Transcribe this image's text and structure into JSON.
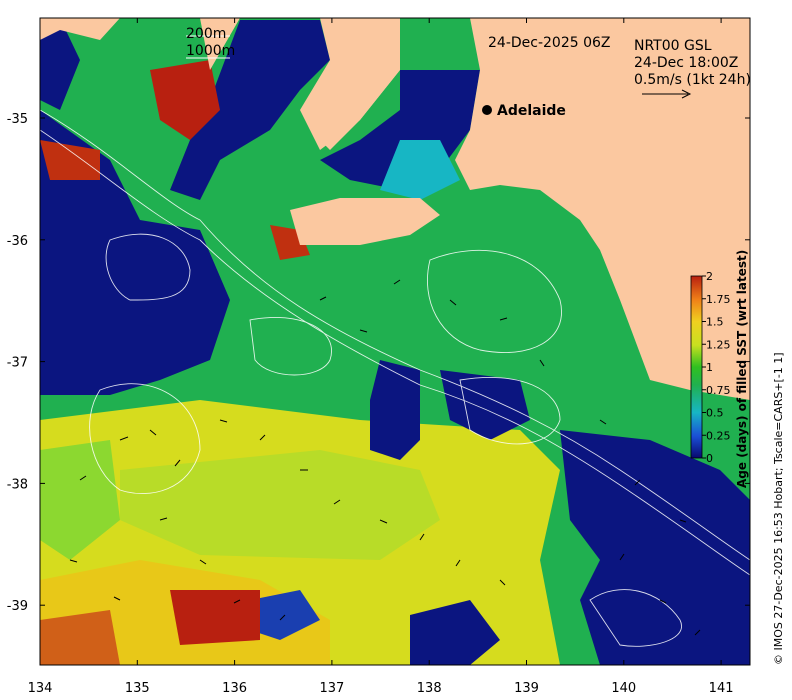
{
  "map": {
    "timestamp": "24-Dec-2025 06Z",
    "product": "NRT00 GSL",
    "current_time": "24-Dec 18:00Z",
    "current_scale": "0.5m/s (1kt 24h)",
    "depth_legend": [
      "200m",
      "1000m"
    ],
    "city": "Adelaide",
    "credit": "© IMOS 27-Dec-2025 16:53 Hobart; Tscale=CARS+[-1 1]",
    "colorbar": {
      "label": "Age (days) of filled SST (wrt latest)",
      "ticks": [
        "0",
        "0.25",
        "0.5",
        "0.75",
        "1",
        "1.25",
        "1.5",
        "1.75",
        "2"
      ],
      "colors": [
        "#08086e",
        "#1a4fd6",
        "#17b6c4",
        "#20b050",
        "#30c020",
        "#c8e020",
        "#f0d020",
        "#f08018",
        "#b82010"
      ]
    },
    "x_axis_ticks": [
      "134",
      "135",
      "136",
      "137",
      "138",
      "139",
      "140",
      "141"
    ],
    "y_axis_ticks": [
      "-35",
      "-36",
      "-37",
      "-38",
      "-39"
    ],
    "colors": {
      "land": "#fbc8a0",
      "deep_water": "#0b1580",
      "frame": "#000000"
    }
  }
}
